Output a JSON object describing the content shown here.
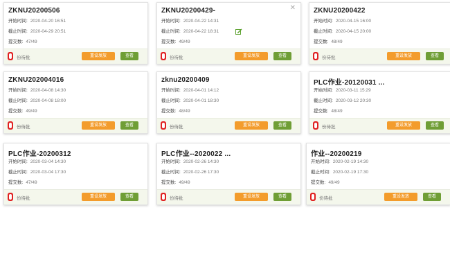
{
  "labels": {
    "start": "开始时间:",
    "end": "截止时间:",
    "submitted": "提交数:",
    "pending": "份待批",
    "reset_button": "重设发放",
    "view_button": "查看"
  },
  "colors": {
    "reset_button": "#f39c2c",
    "view_button": "#6f9e35",
    "ungraded_icon": "#e02020",
    "footer_bg": "#f4f7ec"
  },
  "cards": [
    {
      "title": "ZKNU20200506",
      "start": "2020-04-20 16:51",
      "end": "2020-04-29 20:51",
      "submitted": "47/49",
      "pending_count": "0",
      "pending_visible": false
    },
    {
      "title": "ZKNU20200429-",
      "start": "2020-04-22 14:31",
      "end": "2020-04-22 18:31",
      "submitted": "49/49",
      "pending_count": "0",
      "pending_visible": true
    },
    {
      "title": "ZKNU20200422",
      "start": "2020-04-15 16:00",
      "end": "2020-04-15 20:00",
      "submitted": "48/49",
      "pending_count": "0",
      "pending_visible": true
    },
    {
      "title": "ZKNU202004016",
      "start": "2020-04-08 14:30",
      "end": "2020-04-08 18:00",
      "submitted": "49/49",
      "pending_count": "0",
      "pending_visible": false
    },
    {
      "title": "zknu20200409",
      "start": "2020-04-01 14:12",
      "end": "2020-04-01 18:30",
      "submitted": "48/49",
      "pending_count": "0",
      "pending_visible": true
    },
    {
      "title": "PLC作业-20120031 ...",
      "start": "2020-03-11 15:29",
      "end": "2020-03-12 20:30",
      "submitted": "48/49",
      "pending_count": "0",
      "pending_visible": true
    },
    {
      "title": "PLC作业-20200312",
      "start": "2020-03-04 14:30",
      "end": "2020-03-04 17:30",
      "submitted": "47/49",
      "pending_count": "0",
      "pending_visible": true
    },
    {
      "title": "PLC作业--2020022 ...",
      "start": "2020-02-26 14:30",
      "end": "2020-02-26 17:30",
      "submitted": "49/49",
      "pending_count": "0",
      "pending_visible": true
    },
    {
      "title": "作业--20200219",
      "start": "2020-02-19 14:30",
      "end": "2020-02-19 17:30",
      "submitted": "49/49",
      "pending_count": "0",
      "pending_visible": true
    }
  ]
}
